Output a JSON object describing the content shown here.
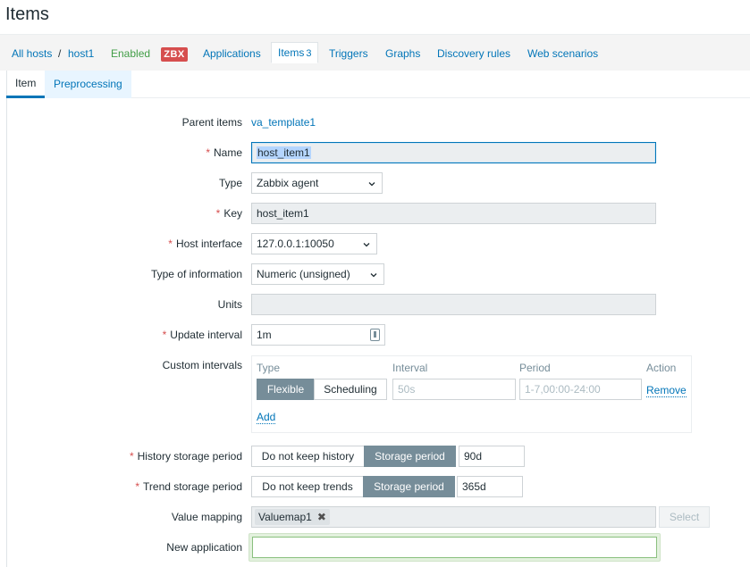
{
  "page": {
    "title": "Items"
  },
  "nav": {
    "all_hosts": "All hosts",
    "separator": "/",
    "host": "host1",
    "status": "Enabled",
    "badge": "ZBX",
    "applications": "Applications",
    "items": "Items",
    "items_count": "3",
    "triggers": "Triggers",
    "graphs": "Graphs",
    "discovery_rules": "Discovery rules",
    "web_scenarios": "Web scenarios"
  },
  "tabs": {
    "item": "Item",
    "preprocessing": "Preprocessing"
  },
  "form": {
    "parent_items": {
      "label": "Parent items",
      "value": "va_template1"
    },
    "name": {
      "label": "Name",
      "value": "host_item1"
    },
    "type": {
      "label": "Type",
      "value": "Zabbix agent"
    },
    "key": {
      "label": "Key",
      "value": "host_item1"
    },
    "host_interface": {
      "label": "Host interface",
      "value": "127.0.0.1:10050"
    },
    "type_of_information": {
      "label": "Type of information",
      "value": "Numeric (unsigned)"
    },
    "units": {
      "label": "Units",
      "value": ""
    },
    "update_interval": {
      "label": "Update interval",
      "value": "1m"
    },
    "custom_intervals": {
      "label": "Custom intervals",
      "headers": {
        "type": "Type",
        "interval": "Interval",
        "period": "Period",
        "action": "Action"
      },
      "mode_flexible": "Flexible",
      "mode_scheduling": "Scheduling",
      "interval_placeholder": "50s",
      "period_placeholder": "1-7,00:00-24:00",
      "remove": "Remove",
      "add": "Add"
    },
    "history": {
      "label": "History storage period",
      "opt_off": "Do not keep history",
      "opt_on": "Storage period",
      "value": "90d"
    },
    "trend": {
      "label": "Trend storage period",
      "opt_off": "Do not keep trends",
      "opt_on": "Storage period",
      "value": "365d"
    },
    "value_mapping": {
      "label": "Value mapping",
      "tag": "Valuemap1",
      "select": "Select"
    },
    "new_application": {
      "label": "New application",
      "value": ""
    },
    "required_mark": "*"
  },
  "colors": {
    "link": "#0275b8",
    "required": "#d64e4e",
    "badge": "#d64e4e",
    "enabled": "#429e47",
    "segment_on": "#768d99"
  }
}
